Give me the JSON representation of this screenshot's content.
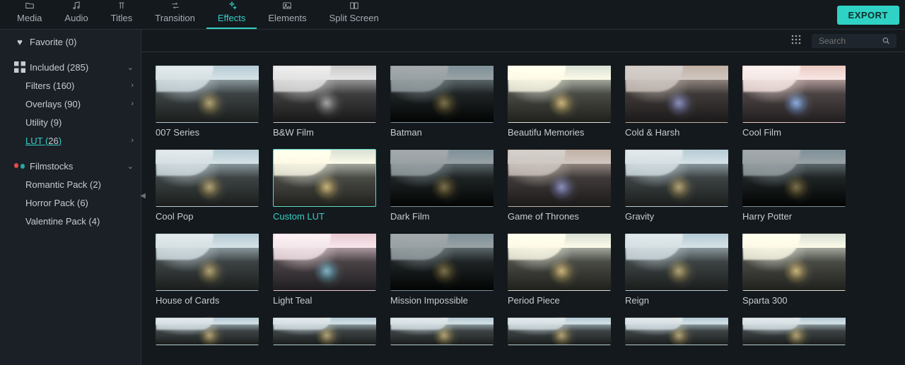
{
  "topnav": {
    "tabs": [
      {
        "label": "Media",
        "icon": "folder"
      },
      {
        "label": "Audio",
        "icon": "music"
      },
      {
        "label": "Titles",
        "icon": "text"
      },
      {
        "label": "Transition",
        "icon": "swap"
      },
      {
        "label": "Effects",
        "icon": "sparkle"
      },
      {
        "label": "Elements",
        "icon": "image"
      },
      {
        "label": "Split Screen",
        "icon": "split"
      }
    ],
    "active_index": 4,
    "export_label": "EXPORT"
  },
  "toolbar": {
    "search_placeholder": "Search"
  },
  "sidebar": {
    "favorite": {
      "label": "Favorite",
      "count": 0
    },
    "included": {
      "label": "Included",
      "count": 285
    },
    "filters": {
      "label": "Filters",
      "count": 160
    },
    "overlays": {
      "label": "Overlays",
      "count": 90
    },
    "utility": {
      "label": "Utility",
      "count": 9
    },
    "lut": {
      "label": "LUT",
      "count": 26
    },
    "filmstocks": {
      "label": "Filmstocks"
    },
    "romantic": {
      "label": "Romantic Pack",
      "count": 2
    },
    "horror": {
      "label": "Horror Pack",
      "count": 6
    },
    "valentine": {
      "label": "Valentine Pack",
      "count": 4
    }
  },
  "grid": {
    "selected_index": 7,
    "items": [
      {
        "label": "007 Series",
        "tint": ""
      },
      {
        "label": "B&W Film",
        "tint": "t-bw"
      },
      {
        "label": "Batman",
        "tint": "t-dark"
      },
      {
        "label": "Beautifu Memories",
        "tint": "t-warm"
      },
      {
        "label": "Cold & Harsh",
        "tint": "t-cold"
      },
      {
        "label": "Cool Film",
        "tint": "t-cool"
      },
      {
        "label": "Cool Pop",
        "tint": ""
      },
      {
        "label": "Custom LUT",
        "tint": "t-warm"
      },
      {
        "label": "Dark Film",
        "tint": "t-dark"
      },
      {
        "label": "Game of Thrones",
        "tint": "t-cold"
      },
      {
        "label": "Gravity",
        "tint": ""
      },
      {
        "label": "Harry Potter",
        "tint": "t-dark"
      },
      {
        "label": "House of Cards",
        "tint": ""
      },
      {
        "label": "Light Teal",
        "tint": "t-teal"
      },
      {
        "label": "Mission Impossible",
        "tint": "t-dark"
      },
      {
        "label": "Period Piece",
        "tint": "t-warm"
      },
      {
        "label": "Reign",
        "tint": ""
      },
      {
        "label": "Sparta 300",
        "tint": "t-warm"
      }
    ],
    "partial_row_count": 6
  }
}
